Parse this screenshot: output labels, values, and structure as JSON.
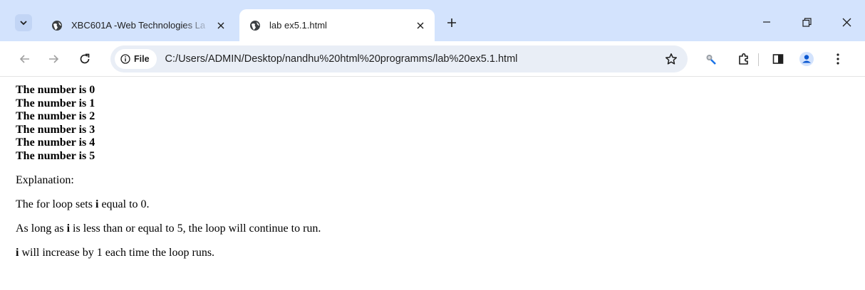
{
  "browser": {
    "tabs": [
      {
        "title": "XBC601A -Web Technologies La",
        "active": false
      },
      {
        "title": "lab ex5.1.html",
        "active": true
      }
    ],
    "address": {
      "chip_label": "File",
      "url": "C:/Users/ADMIN/Desktop/nandhu%20html%20programms/lab%20ex5.1.html"
    },
    "accent_color": "#d3e3fd",
    "icons": [
      "tab-search-icon",
      "globe-icon",
      "close-icon",
      "plus-icon",
      "minimize-icon",
      "restore-icon",
      "back-icon",
      "forward-icon",
      "reload-icon",
      "info-icon",
      "star-icon",
      "extension-puzzle-icon",
      "side-panel-icon",
      "profile-icon",
      "kebab-menu-icon"
    ]
  },
  "page": {
    "numbers": [
      "The number is 0",
      "The number is 1",
      "The number is 2",
      "The number is 3",
      "The number is 4",
      "The number is 5"
    ],
    "explanation_heading": "Explanation:",
    "p1": {
      "before": "The for loop sets ",
      "bold": "i",
      "after": " equal to 0."
    },
    "p2": {
      "before": "As long as ",
      "bold": "i",
      "after": " is less than or equal to 5, the loop will continue to run."
    },
    "p3": {
      "bold": "i",
      "after": " will increase by 1 each time the loop runs."
    }
  }
}
